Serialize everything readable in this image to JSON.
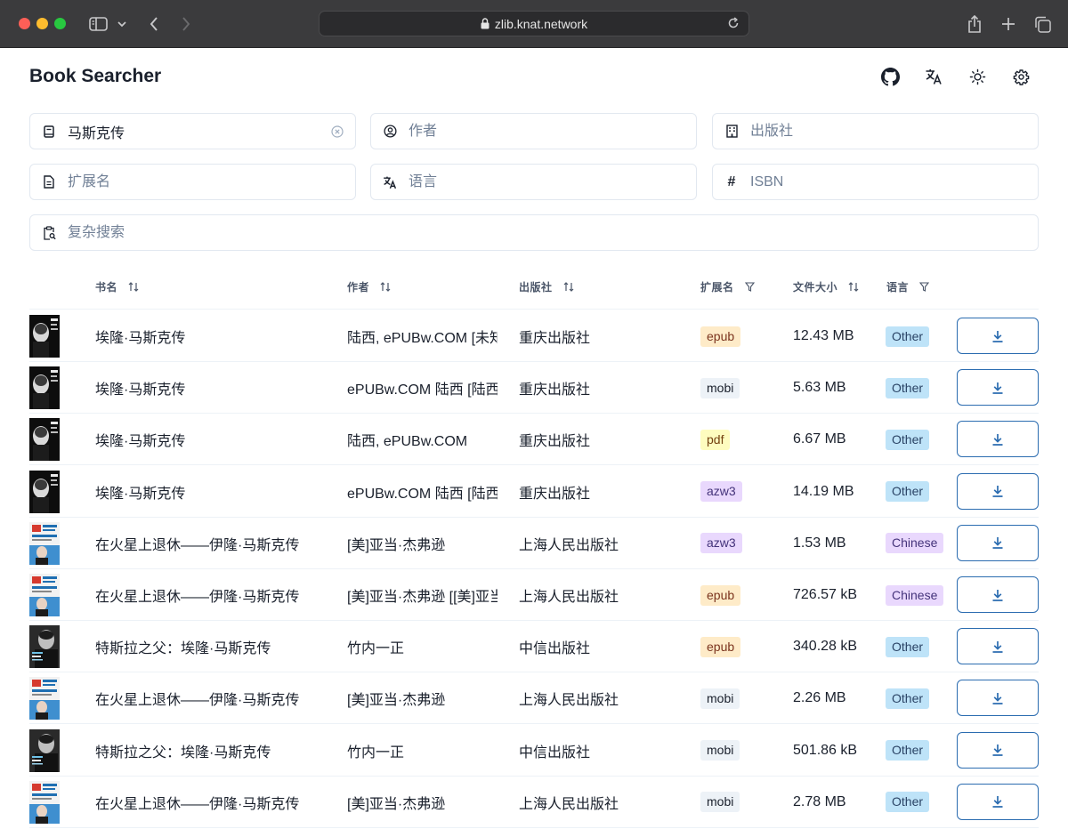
{
  "browser": {
    "url": "zlib.knat.network"
  },
  "app": {
    "title": "Book Searcher"
  },
  "header_icons": [
    "github-icon",
    "translate-icon",
    "sun-icon",
    "gear-icon"
  ],
  "search": {
    "title_value": "马斯克传",
    "author_placeholder": "作者",
    "publisher_placeholder": "出版社",
    "extension_placeholder": "扩展名",
    "language_placeholder": "语言",
    "isbn_placeholder": "ISBN",
    "complex_placeholder": "复杂搜索"
  },
  "table": {
    "headers": {
      "title": "书名",
      "author": "作者",
      "publisher": "出版社",
      "extension": "扩展名",
      "filesize": "文件大小",
      "language": "语言"
    },
    "rows": [
      {
        "cover": "musk-bio-black",
        "title": "埃隆·马斯克传",
        "author": "陆西, ePUBw.COM [未知]",
        "publisher": "重庆出版社",
        "extension": "epub",
        "filesize": "12.43 MB",
        "language": "Other"
      },
      {
        "cover": "musk-bio-black",
        "title": "埃隆·马斯克传",
        "author": "ePUBw.COM 陆西 [陆西]",
        "publisher": "重庆出版社",
        "extension": "mobi",
        "filesize": "5.63 MB",
        "language": "Other"
      },
      {
        "cover": "musk-bio-black",
        "title": "埃隆·马斯克传",
        "author": "陆西, ePUBw.COM",
        "publisher": "重庆出版社",
        "extension": "pdf",
        "filesize": "6.67 MB",
        "language": "Other"
      },
      {
        "cover": "musk-bio-black",
        "title": "埃隆·马斯克传",
        "author": "ePUBw.COM 陆西 [陆西]",
        "publisher": "重庆出版社",
        "extension": "azw3",
        "filesize": "14.19 MB",
        "language": "Other"
      },
      {
        "cover": "mars-retire",
        "title": "在火星上退休——伊隆·马斯克传",
        "author": "[美]亚当·杰弗逊",
        "publisher": "上海人民出版社",
        "extension": "azw3",
        "filesize": "1.53 MB",
        "language": "Chinese"
      },
      {
        "cover": "mars-retire",
        "title": "在火星上退休——伊隆·马斯克传",
        "author": "[美]亚当·杰弗逊 [[美]亚当·杰弗逊]",
        "publisher": "上海人民出版社",
        "extension": "epub",
        "filesize": "726.57 kB",
        "language": "Chinese"
      },
      {
        "cover": "tesla-father",
        "title": "特斯拉之父：埃隆·马斯克传",
        "author": "竹内一正",
        "publisher": "中信出版社",
        "extension": "epub",
        "filesize": "340.28 kB",
        "language": "Other"
      },
      {
        "cover": "mars-retire",
        "title": "在火星上退休——伊隆·马斯克传",
        "author": "[美]亚当·杰弗逊",
        "publisher": "上海人民出版社",
        "extension": "mobi",
        "filesize": "2.26 MB",
        "language": "Other"
      },
      {
        "cover": "tesla-father",
        "title": "特斯拉之父：埃隆·马斯克传",
        "author": "竹内一正",
        "publisher": "中信出版社",
        "extension": "mobi",
        "filesize": "501.86 kB",
        "language": "Other"
      },
      {
        "cover": "mars-retire",
        "title": "在火星上退休——伊隆·马斯克传",
        "author": "[美]亚当·杰弗逊",
        "publisher": "上海人民出版社",
        "extension": "mobi",
        "filesize": "2.78 MB",
        "language": "Other"
      }
    ]
  },
  "colors": {
    "ext_epub_bg": "#feebc8",
    "ext_epub_fg": "#7b341e",
    "ext_mobi_bg": "#edf2f7",
    "ext_mobi_fg": "#1a202c",
    "ext_pdf_bg": "#fefcbf",
    "ext_pdf_fg": "#744210",
    "ext_azw3_bg": "#e9d8fd",
    "ext_azw3_fg": "#44337a",
    "lang_other_bg": "#bee3f8",
    "lang_other_fg": "#2a4365",
    "lang_chinese_bg": "#e9d8fd",
    "lang_chinese_fg": "#44337a",
    "accent": "#2b6cb0"
  }
}
